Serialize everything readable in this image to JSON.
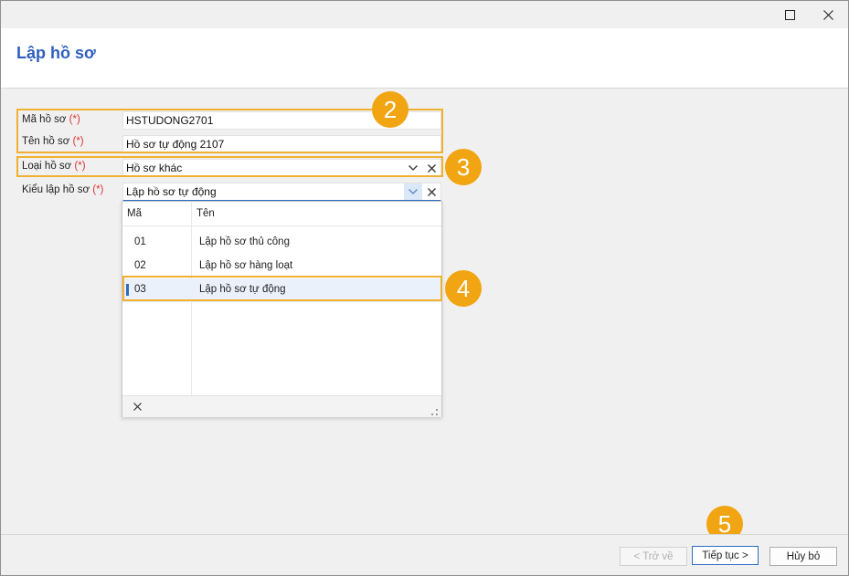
{
  "window": {
    "maximize_glyph": "☐",
    "close_glyph": "✕"
  },
  "header": {
    "title": "Lập hồ sơ"
  },
  "form": {
    "required_mark": "(*)",
    "ma_ho_so": {
      "label": "Mã hồ sơ",
      "value": "HSTUDONG2701"
    },
    "ten_ho_so": {
      "label": "Tên hồ sơ",
      "value": "Hồ sơ tự động 2107"
    },
    "loai_ho_so": {
      "label": "Loại hồ sơ",
      "value": "Hồ sơ khác"
    },
    "kieu_lap_ho_so": {
      "label": "Kiểu lập hồ sơ",
      "value": "Lập hồ sơ tự động"
    }
  },
  "dropdown": {
    "columns": [
      "Mã",
      "Tên"
    ],
    "rows": [
      {
        "code": "01",
        "name": "Lập hồ sơ thủ công"
      },
      {
        "code": "02",
        "name": "Lập hồ sơ hàng loạt"
      },
      {
        "code": "03",
        "name": "Lập hồ sơ tự động"
      }
    ],
    "selected_index": 2
  },
  "badges": [
    "2",
    "3",
    "4",
    "5"
  ],
  "footer": {
    "back_label": "< Trở về",
    "next_label": "Tiếp tục >",
    "cancel_label": "Hủy bỏ"
  },
  "colors": {
    "accent": "#2e5fbf",
    "highlight": "#f0b030",
    "badge": "#f1a512",
    "required": "#dd3333"
  }
}
